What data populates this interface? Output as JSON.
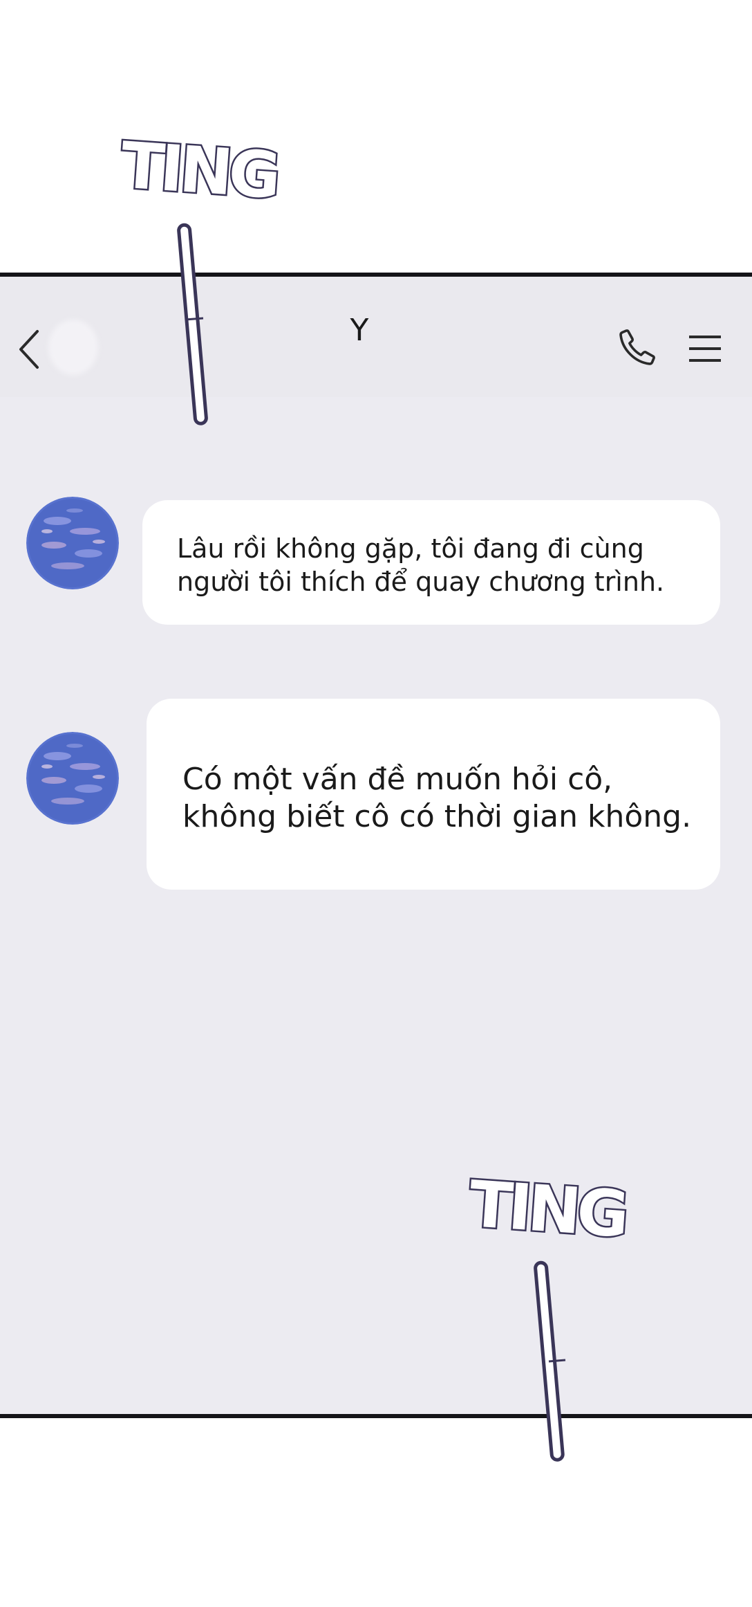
{
  "chat": {
    "contact_name": "Y"
  },
  "messages": [
    {
      "lines": [
        "Lâu rồi không gặp, tôi đang đi cùng",
        "người tôi thích để quay chương trình."
      ]
    },
    {
      "lines": [
        "Có một vấn đề muốn hỏi cô,",
        "không biết cô có thời gian không."
      ]
    }
  ],
  "sound_effects": [
    "TING",
    "TING"
  ],
  "icons": {
    "back": "chevron-left-icon",
    "call": "phone-icon",
    "menu": "hamburger-menu-icon"
  },
  "colors": {
    "screen_bg": "#ecebf1",
    "header_bg": "#eae9ee",
    "bubble_bg": "#ffffff",
    "text": "#1a1a1a",
    "sfx_outline": "#3a3558",
    "avatar_blue": "#5872cf"
  }
}
